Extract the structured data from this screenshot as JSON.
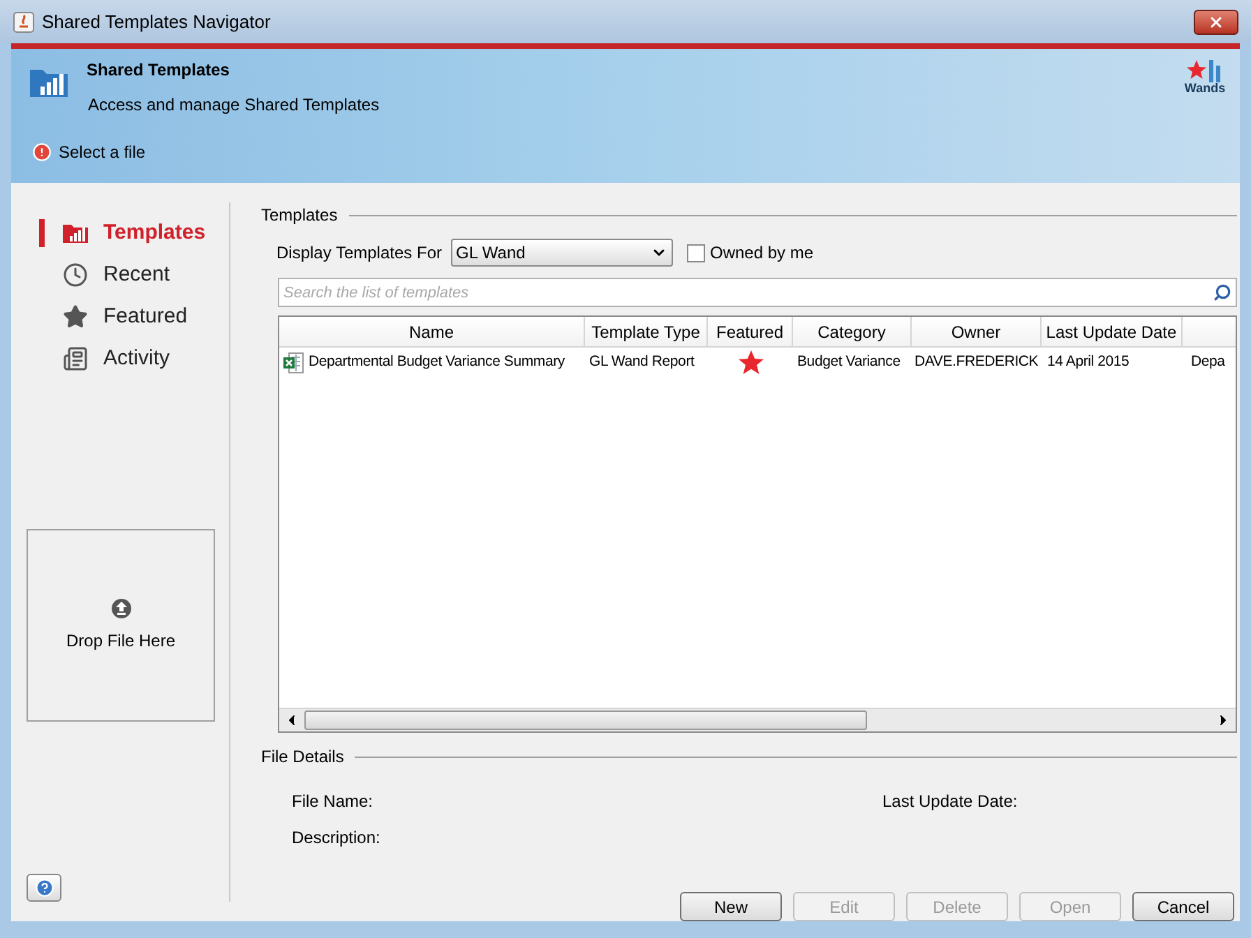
{
  "window": {
    "title": "Shared Templates Navigator"
  },
  "header": {
    "title": "Shared Templates",
    "subtitle": "Access and manage Shared Templates",
    "logo_text": "Wands",
    "message": "Select a file"
  },
  "nav": [
    {
      "label": "Templates",
      "selected": true,
      "kind": "templates"
    },
    {
      "label": "Recent",
      "selected": false,
      "kind": "recent"
    },
    {
      "label": "Featured",
      "selected": false,
      "kind": "featured"
    },
    {
      "label": "Activity",
      "selected": false,
      "kind": "activity"
    }
  ],
  "drop_zone": {
    "label": "Drop File Here"
  },
  "templates": {
    "legend": "Templates",
    "filter_label": "Display Templates For",
    "filter_value": "GL Wand",
    "owned_by_me": {
      "label": "Owned by me",
      "checked": false
    },
    "search_placeholder": "Search the list of templates",
    "columns": [
      "Name",
      "Template Type",
      "Featured",
      "Category",
      "Owner",
      "Last Update Date"
    ],
    "rows": [
      {
        "name": "Departmental Budget Variance Summary",
        "template_type": "GL Wand Report",
        "featured": true,
        "category": "Budget Variance",
        "owner": "DAVE.FREDERICK",
        "last_update_date": "14 April 2015",
        "column_7": "Depa"
      }
    ]
  },
  "file_details": {
    "legend": "File Details",
    "file_name_label": "File Name:",
    "last_update_label": "Last Update Date:",
    "description_label": "Description:"
  },
  "buttons": [
    {
      "label": "New",
      "disabled": false
    },
    {
      "label": "Edit",
      "disabled": true
    },
    {
      "label": "Delete",
      "disabled": true
    },
    {
      "label": "Open",
      "disabled": true
    },
    {
      "label": "Cancel",
      "disabled": false
    }
  ]
}
